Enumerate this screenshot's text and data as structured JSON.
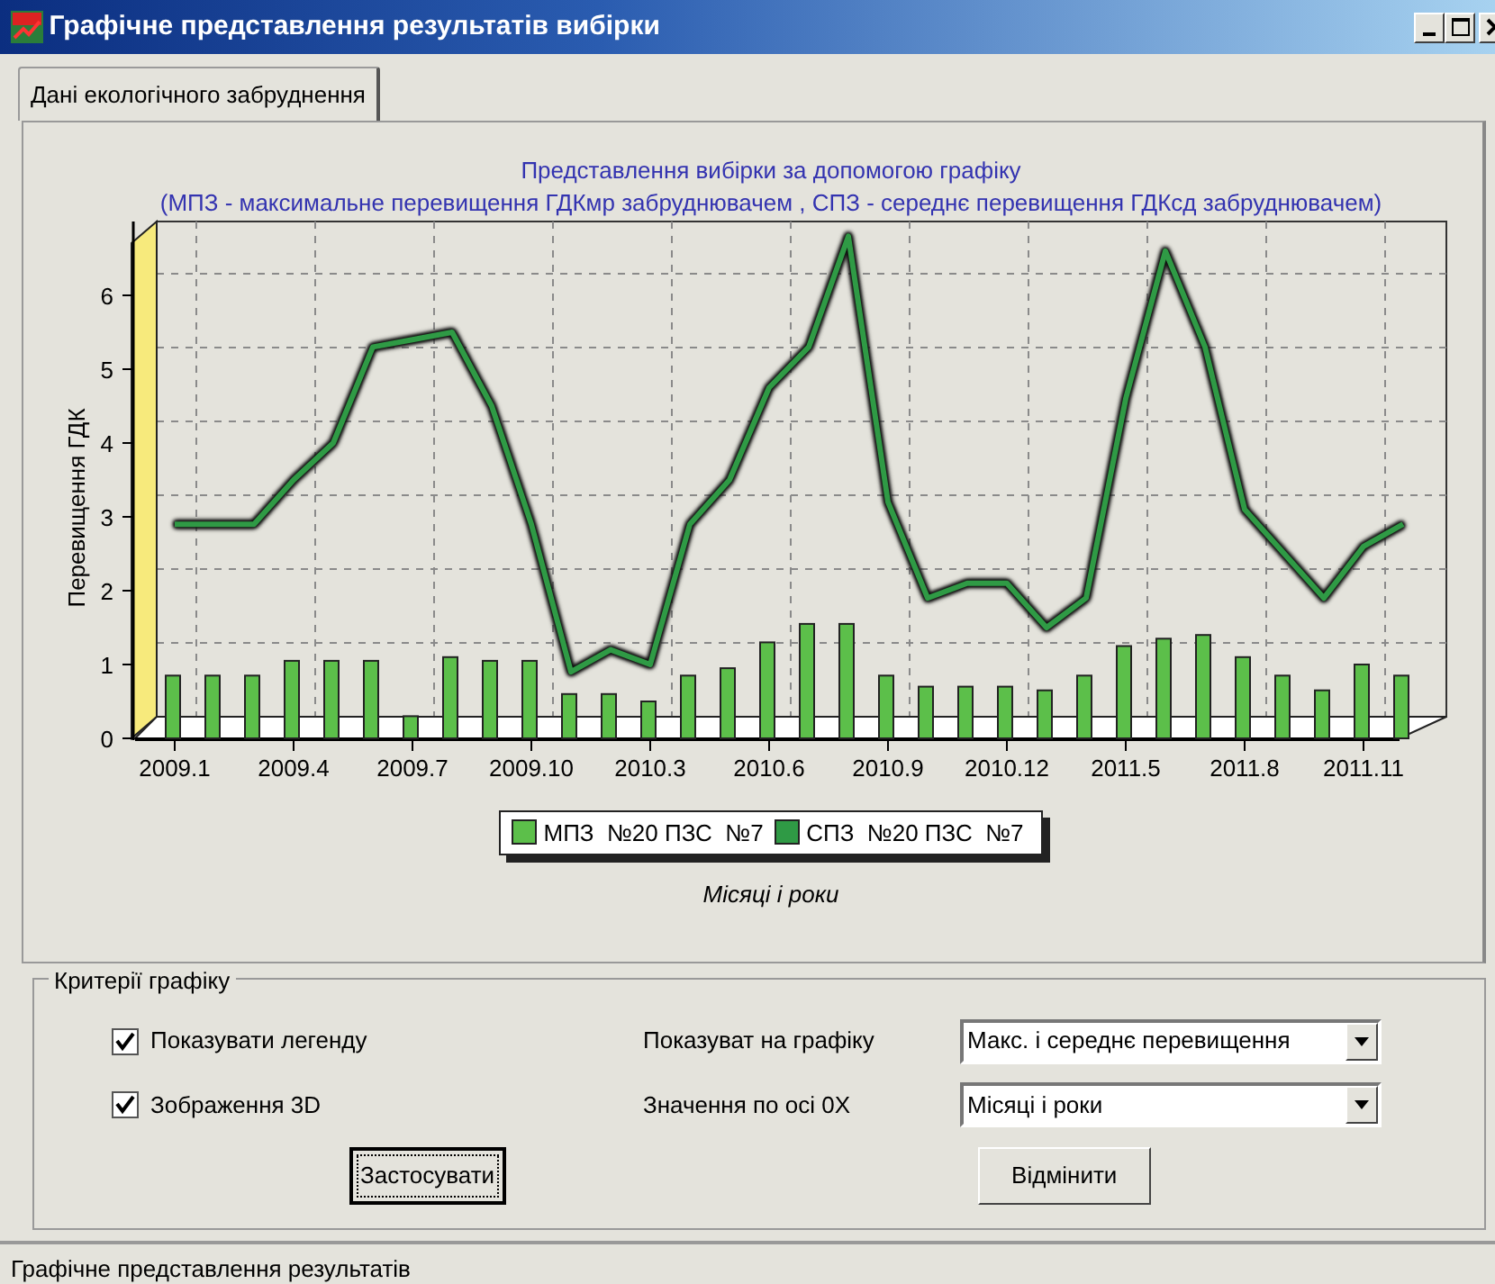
{
  "window": {
    "title": "Графічне представлення результатів вибірки"
  },
  "tabs": [
    {
      "label": "Дані екологічного забруднення",
      "selected": true
    }
  ],
  "chart_panel": {
    "subtitle": "(МПЗ - максимальне перевищення ГДКмр забруднювачем , СПЗ - середнє перевищення ГДКсд забруднювачем)",
    "chart_data": {
      "type": "bar",
      "title": "Представлення вибірки за допомогою графіку",
      "xlabel": "Місяці і роки",
      "ylabel": "Перевищення ГДК",
      "categories": [
        "2009.1",
        null,
        null,
        "2009.4",
        null,
        null,
        "2009.7",
        null,
        null,
        "2009.10",
        null,
        null,
        "2010.3",
        null,
        null,
        "2010.6",
        null,
        null,
        "2010.9",
        null,
        null,
        "2010.12",
        null,
        null,
        "2011.5",
        null,
        null,
        "2011.8",
        null,
        null,
        "2011.11",
        null
      ],
      "series": [
        {
          "name": "МПЗ  №20 ПЗС  №7",
          "type": "bar",
          "color": "#5cbf4a",
          "values": [
            0.85,
            0.85,
            0.85,
            1.05,
            1.05,
            1.05,
            0.3,
            1.1,
            1.05,
            1.05,
            0.6,
            0.6,
            0.5,
            0.85,
            0.95,
            1.3,
            1.55,
            1.55,
            0.85,
            0.7,
            0.7,
            0.7,
            0.65,
            0.85,
            1.25,
            1.35,
            1.4,
            1.1,
            0.85,
            0.65,
            1.0,
            0.85
          ]
        },
        {
          "name": "СПЗ  №20 ПЗС  №7",
          "type": "line",
          "color": "#2f9a45",
          "values": [
            2.9,
            2.9,
            2.9,
            3.5,
            4.0,
            5.3,
            5.4,
            5.5,
            4.5,
            2.9,
            0.9,
            1.2,
            1.0,
            2.9,
            3.5,
            4.75,
            5.3,
            6.8,
            3.2,
            1.9,
            2.1,
            2.1,
            1.5,
            1.9,
            4.6,
            6.6,
            5.3,
            3.1,
            2.5,
            1.9,
            2.6,
            2.9
          ]
        }
      ],
      "ylim": [
        0,
        7
      ],
      "yticks": [
        0,
        1,
        2,
        3,
        4,
        5,
        6
      ]
    }
  },
  "criteria": {
    "title": "Критерії графіку",
    "checkboxes": [
      {
        "label": "Показувати легенду",
        "checked": true
      },
      {
        "label": "Зображення 3D",
        "checked": true
      }
    ],
    "selects": [
      {
        "label": "Показуват на графіку",
        "value": "Макс. і середнє перевищення"
      },
      {
        "label": "Значення по осі 0X",
        "value": "Місяці і роки"
      }
    ],
    "buttons": [
      {
        "label": "Застосувати",
        "default": true
      },
      {
        "label": "Відмінити",
        "default": false
      }
    ]
  },
  "status_bar": "Графічне представлення результатів"
}
